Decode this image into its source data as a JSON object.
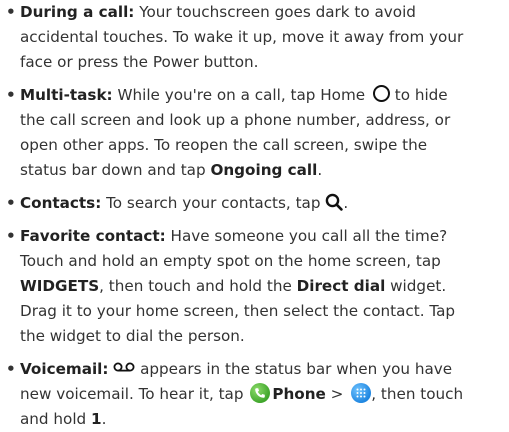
{
  "items": [
    {
      "title": "During a call:",
      "lines": [
        "Your touchscreen goes dark to avoid",
        "accidental touches. To wake it up, move it away from your",
        "face or press the Power button."
      ]
    },
    {
      "title": "Multi-task:",
      "line1_a": "While you're on a call, tap Home",
      "line1_b": "to hide",
      "lines": [
        "the call screen and look up a phone number, address, or",
        "open other apps. To reopen the call screen, swipe the",
        "status bar down and tap"
      ],
      "emphasis": "Ongoing call",
      "end": "."
    },
    {
      "title": "Contacts:",
      "text": "To search your contacts, tap",
      "end": "."
    },
    {
      "title": "Favorite contact:",
      "line1": "Have someone you call all the time?",
      "line2": "Touch and hold an empty spot on the home screen, tap",
      "widgets": "WIDGETS",
      "line3_mid": ", then touch and hold the",
      "direct_dial": "Direct dial",
      "line3_end": "widget.",
      "line4": "Drag it to your home screen, then select the contact. Tap",
      "line5": "the widget to dial the person."
    },
    {
      "title": "Voicemail:",
      "line1": "appears in the status bar when you have",
      "line2_a": "new voicemail. To hear it, tap",
      "phone": "Phone",
      "sep": ">",
      "line2_b": ", then touch",
      "line3_a": "and hold",
      "key": "1",
      "end": "."
    }
  ],
  "icons": {
    "home": "home-circle-icon",
    "search": "search-icon",
    "voicemail": "voicemail-icon",
    "phone": "phone-app-icon",
    "dialpad": "dialpad-icon"
  },
  "colors": {
    "text": "#333333",
    "phone_icon": "#3fa52b",
    "dialpad_icon": "#1f86e0"
  }
}
